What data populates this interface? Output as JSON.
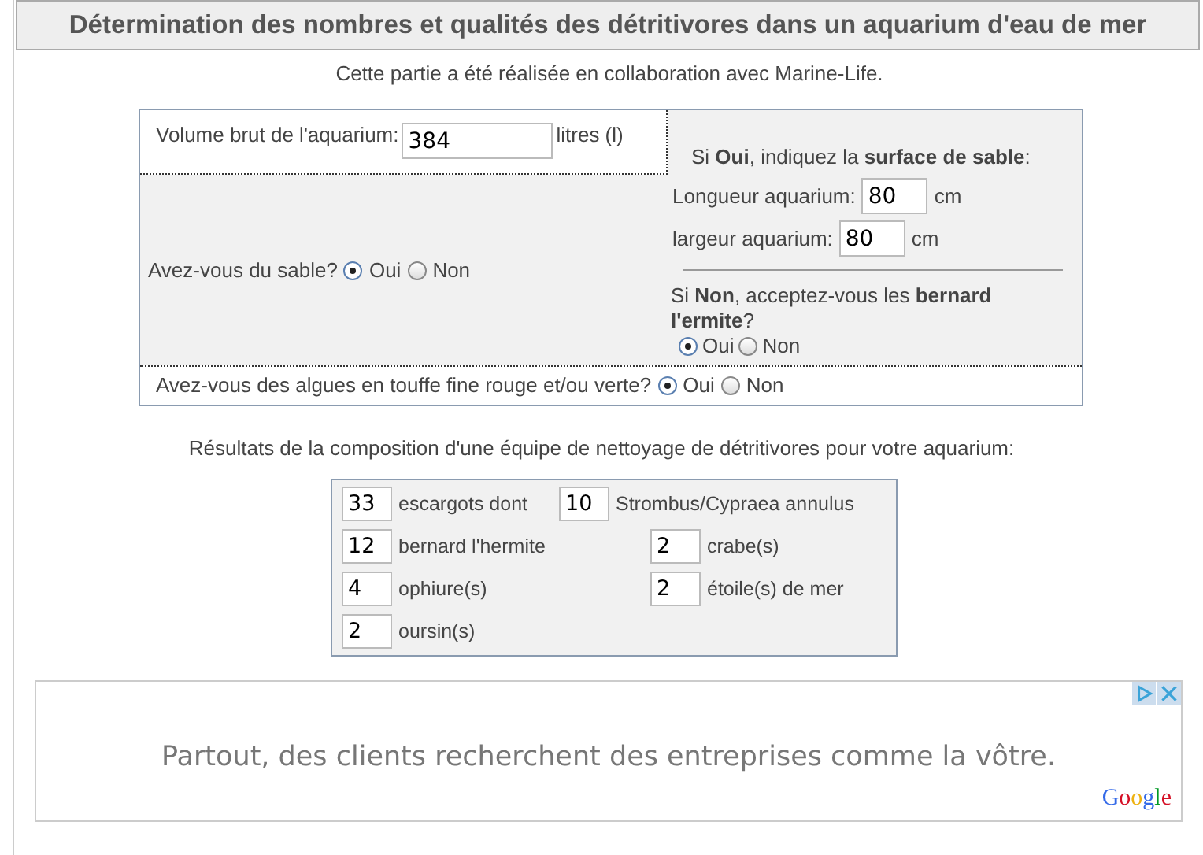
{
  "title": "Détermination des nombres et qualités des détritivores dans un aquarium d'eau de mer",
  "subtitle": "Cette partie a été réalisée en collaboration avec Marine-Life.",
  "form": {
    "volume": {
      "label": "Volume brut de l'aquarium:",
      "value": "384",
      "unit": "litres (l)"
    },
    "sand": {
      "question": "Avez-vous du sable?",
      "options": [
        {
          "label": "Oui",
          "selected": true
        },
        {
          "label": "Non",
          "selected": false
        }
      ]
    },
    "sand_yes": {
      "heading": "Si **Oui**, indiquez la **surface de sable**:",
      "fields": [
        {
          "label": "Longueur aquarium:",
          "value": "80",
          "unit": "cm"
        },
        {
          "label": "largeur aquarium:",
          "value": "80",
          "unit": "cm"
        }
      ]
    },
    "sand_no": {
      "question": "Si **Non**, acceptez-vous les **bernard l'ermite**?",
      "options": [
        {
          "label": "Oui",
          "selected": true
        },
        {
          "label": "Non",
          "selected": false
        }
      ]
    },
    "algae": {
      "question": "Avez-vous des algues en touffe fine rouge et/ou verte?",
      "options": [
        {
          "label": "Oui",
          "selected": true
        },
        {
          "label": "Non",
          "selected": false
        }
      ]
    }
  },
  "results_heading": "Résultats de la composition d'une équipe de nettoyage de détritivores pour votre aquarium:",
  "results": [
    [
      {
        "value": "33",
        "label": "escargots dont"
      },
      {
        "value": "10",
        "label": "Strombus/Cypraea annulus"
      }
    ],
    [
      {
        "value": "12",
        "label": "bernard l'hermite"
      },
      {
        "value": "2",
        "label": "crabe(s)"
      }
    ],
    [
      {
        "value": "4",
        "label": "ophiure(s)"
      },
      {
        "value": "2",
        "label": "étoile(s) de mer"
      }
    ],
    [
      {
        "value": "2",
        "label": "oursin(s)"
      }
    ]
  ],
  "ad": {
    "text": "Partout, des clients recherchent des entreprises comme la vôtre.",
    "brand": "Google"
  }
}
